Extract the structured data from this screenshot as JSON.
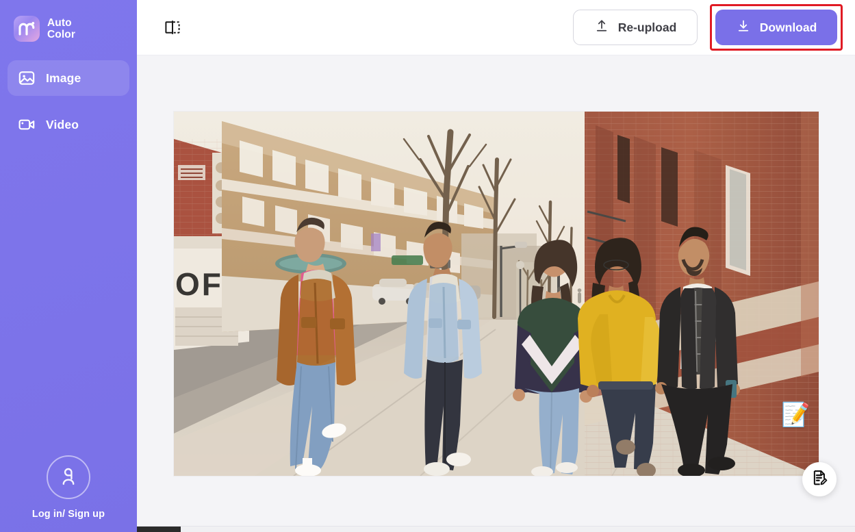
{
  "app": {
    "brand_name": "Auto\nColor",
    "logo_icon": "media-io-m-logo"
  },
  "sidebar": {
    "items": [
      {
        "label": "Image",
        "icon": "image-icon",
        "active": true
      },
      {
        "label": "Video",
        "icon": "video-camera-icon",
        "active": false
      }
    ],
    "account": {
      "label": "Log in/ Sign up",
      "icon": "user-avatar-icon"
    },
    "background_color": "#7d74ea",
    "active_item_color": "rgba(255,255,255,0.13)"
  },
  "topbar": {
    "compare_icon": "compare-split-view-icon",
    "reupload_label": "Re-upload",
    "reupload_icon": "upload-arrow-icon",
    "download_label": "Download",
    "download_icon": "download-arrow-icon",
    "download_color": "#7a70e8",
    "highlight_color": "#e01b24",
    "highlighted_element": "download-button"
  },
  "canvas": {
    "background_color": "#f4f4f7",
    "image_alt": "Five young friends walking and laughing together down a city sidewalk beside a red brick building",
    "sticker": "📝"
  },
  "feedback": {
    "icon": "document-edit-icon",
    "label": "Feedback"
  },
  "scrollbar": {
    "orientation": "horizontal",
    "thumb_position": "start"
  }
}
